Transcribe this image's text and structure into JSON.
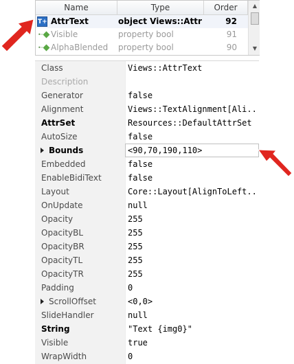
{
  "list": {
    "columns": [
      "Name",
      "Type",
      "Order"
    ],
    "rows": [
      {
        "name": "AttrText",
        "type": "object Views::AttrText",
        "order": "92",
        "icon": "t-plus-icon",
        "selected": true
      },
      {
        "name": "Visible",
        "type": "property bool",
        "order": "91",
        "icon": "diamond-icon",
        "selected": false
      },
      {
        "name": "AlphaBlended",
        "type": "property bool",
        "order": "90",
        "icon": "diamond-icon",
        "selected": false
      }
    ],
    "scroll_up_glyph": "▲",
    "scroll_down_glyph": "▼"
  },
  "properties": [
    {
      "name": "Class",
      "value": "Views::AttrText"
    },
    {
      "name": "Description",
      "value": ""
    },
    {
      "name": "Generator",
      "value": "false"
    },
    {
      "name": "Alignment",
      "value": "Views::TextAlignment[Ali..."
    },
    {
      "name": "AttrSet",
      "value": "Resources::DefaultAttrSet"
    },
    {
      "name": "AutoSize",
      "value": "false"
    },
    {
      "name": "Bounds",
      "value": "<90,70,190,110>"
    },
    {
      "name": "Embedded",
      "value": "false"
    },
    {
      "name": "EnableBidiText",
      "value": "false"
    },
    {
      "name": "Layout",
      "value": "Core::Layout[AlignToLeft..."
    },
    {
      "name": "OnUpdate",
      "value": "null"
    },
    {
      "name": "Opacity",
      "value": "255"
    },
    {
      "name": "OpacityBL",
      "value": "255"
    },
    {
      "name": "OpacityBR",
      "value": "255"
    },
    {
      "name": "OpacityTL",
      "value": "255"
    },
    {
      "name": "OpacityTR",
      "value": "255"
    },
    {
      "name": "Padding",
      "value": "0"
    },
    {
      "name": "ScrollOffset",
      "value": "<0,0>"
    },
    {
      "name": "SlideHandler",
      "value": "null"
    },
    {
      "name": "String",
      "value": "\"Text {img0}\""
    },
    {
      "name": "Visible",
      "value": "true"
    },
    {
      "name": "WrapWidth",
      "value": "0"
    }
  ],
  "colors": {
    "annotation_arrow": "#e0261f",
    "icon_blue": "#2c6fc4",
    "diamond_green": "#5aa845"
  }
}
